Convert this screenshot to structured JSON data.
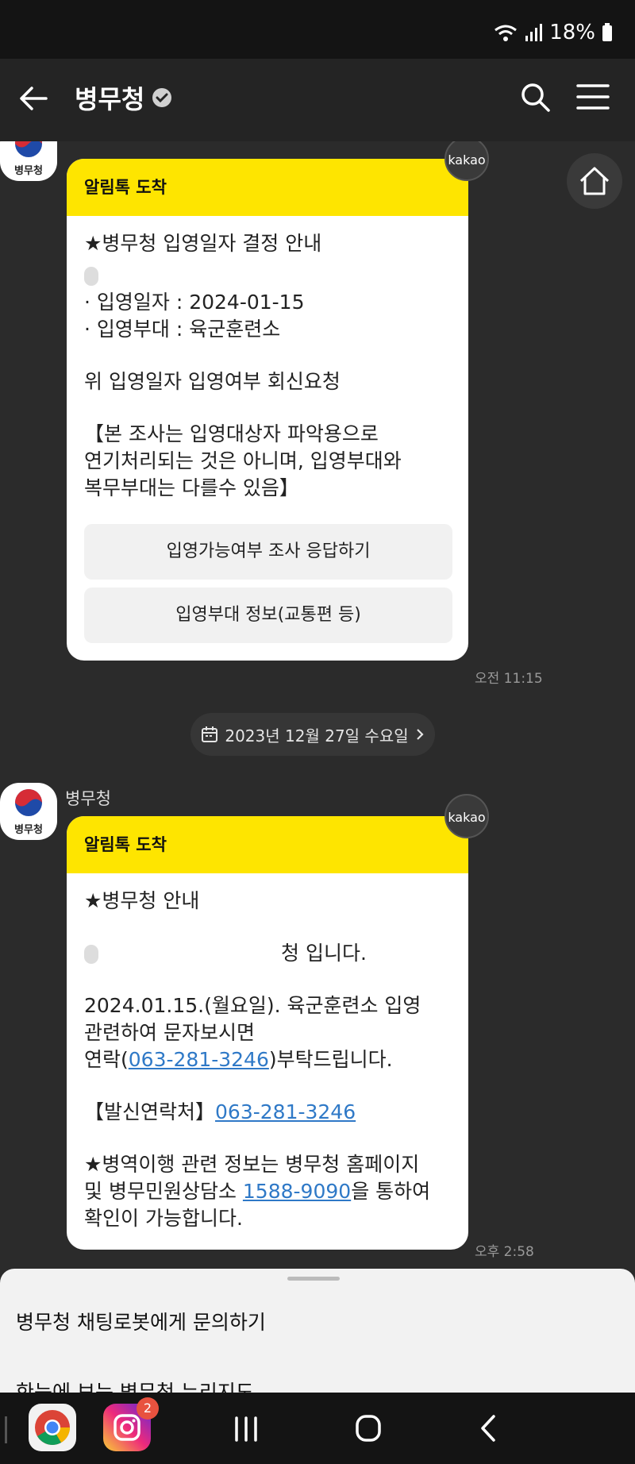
{
  "status_bar": {
    "battery": "18%"
  },
  "app_bar": {
    "title": "병무청"
  },
  "messages": [
    {
      "sender": "병무청",
      "header": "알림톡 도착",
      "body_lines": [
        "★병무청 입영일자 결정 안내",
        "",
        "· 입영일자 : 2024-01-15",
        "· 입영부대 : 육군훈련소",
        "",
        "위 입영일자 입영여부 회신요청",
        "",
        "【본 조사는 입영대상자 파악용으로",
        "연기처리되는 것은 아니며, 입영부대와",
        "복무부대는 다를수 있음】"
      ],
      "buttons": [
        "입영가능여부 조사 응답하기",
        "입영부대 정보(교통편 등)"
      ],
      "time": "오전 11:15",
      "kakao_badge": "kakao"
    },
    {
      "sender": "병무청",
      "header": "알림톡 도착",
      "body_lines": [
        "★병무청 안내",
        "청 입니다.",
        "2024.01.15.(월요일). 육군훈련소 입영",
        "관련하여 문자보시면",
        "연락(",
        "063-281-3246",
        ")부탁드립니다.",
        "【발신연락처】",
        "063-281-3246",
        "★병역이행 관련 정보는 병무청 홈페이지",
        "및 병무민원상담소 ",
        "1588-9090",
        "을 통하여",
        "확인이 가능합니다."
      ],
      "time": "오후 2:58",
      "kakao_badge": "kakao"
    }
  ],
  "date_divider": "2023년 12월 27일 수요일",
  "avatar_label": "병무청",
  "bottom_sheet": {
    "items": [
      "병무청 채팅로봇에게 문의하기",
      "한눈에 보는 병무청 누리지도"
    ]
  },
  "nav_bar": {
    "instagram_badge": "2"
  },
  "colors": {
    "kakao_yellow": "#fee500",
    "link": "#2f79c7",
    "background": "#2b2b2b"
  }
}
